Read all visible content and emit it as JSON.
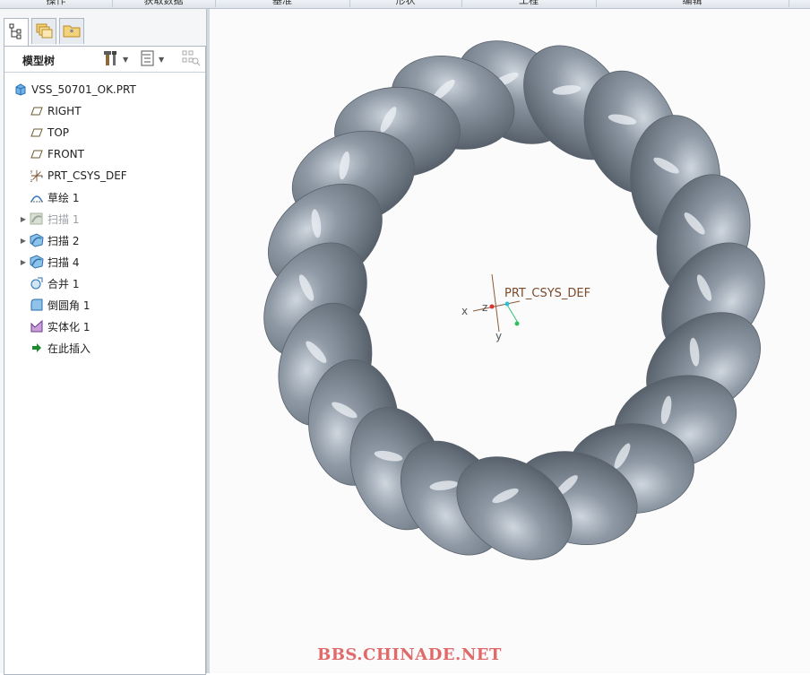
{
  "ribbon": {
    "groups": [
      "操作",
      "获取数据",
      "基准",
      "形状",
      "工程",
      "编辑"
    ]
  },
  "left_panel": {
    "tabs": [
      {
        "name": "model-tree-tab",
        "icon": "tree-icon",
        "active": true
      },
      {
        "name": "folder-browser-tab",
        "icon": "folders-icon",
        "active": false
      },
      {
        "name": "favorites-tab",
        "icon": "favorites-icon",
        "active": false
      }
    ],
    "title": "模型树",
    "tools": [
      "settings-tools-icon",
      "tree-filter-icon",
      "display-icon"
    ]
  },
  "tree": {
    "root": "VSS_50701_OK.PRT",
    "items": [
      {
        "label": "RIGHT",
        "icon": "datum-plane-icon",
        "expandable": false,
        "dim": false
      },
      {
        "label": "TOP",
        "icon": "datum-plane-icon",
        "expandable": false,
        "dim": false
      },
      {
        "label": "FRONT",
        "icon": "datum-plane-icon",
        "expandable": false,
        "dim": false
      },
      {
        "label": "PRT_CSYS_DEF",
        "icon": "coordinate-system-icon",
        "expandable": false,
        "dim": false
      },
      {
        "label": "草绘 1",
        "icon": "sketch-icon",
        "expandable": false,
        "dim": false
      },
      {
        "label": "扫描 1",
        "icon": "sweep-icon",
        "expandable": true,
        "dim": true
      },
      {
        "label": "扫描 2",
        "icon": "sweep-icon",
        "expandable": true,
        "dim": false
      },
      {
        "label": "扫描 4",
        "icon": "sweep-icon",
        "expandable": true,
        "dim": false
      },
      {
        "label": "合并 1",
        "icon": "merge-icon",
        "expandable": false,
        "dim": false
      },
      {
        "label": "倒圆角 1",
        "icon": "round-icon",
        "expandable": false,
        "dim": false
      },
      {
        "label": "实体化 1",
        "icon": "solidify-icon",
        "expandable": false,
        "dim": false
      },
      {
        "label": "在此插入",
        "icon": "insert-here-icon",
        "expandable": false,
        "dim": false
      }
    ]
  },
  "viewport": {
    "csys_label": "PRT_CSYS_DEF",
    "axis_x": "x",
    "axis_y": "y",
    "axis_z": "z",
    "model_color": "#7a8591",
    "watermark": "BBS.CHINADE.NET"
  }
}
